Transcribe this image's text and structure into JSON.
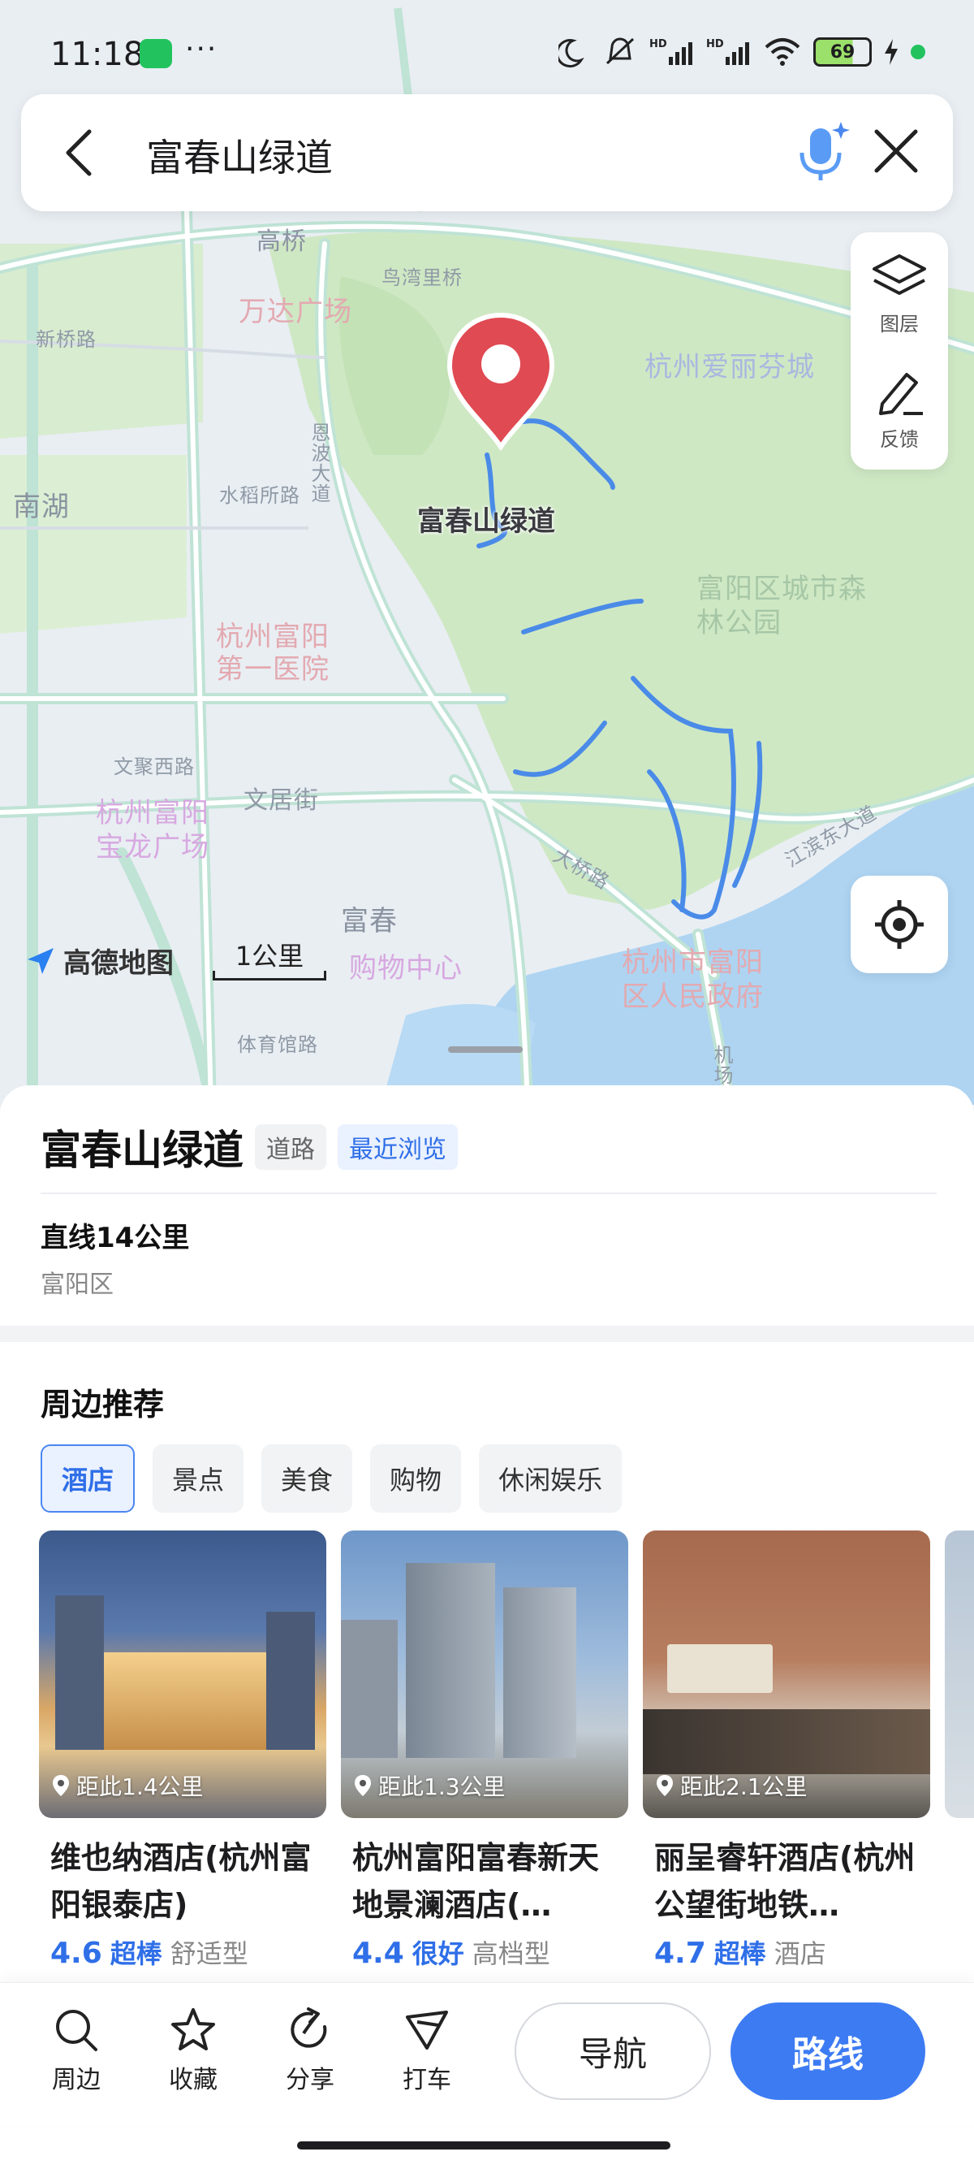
{
  "status": {
    "time": "11:18",
    "more": "···",
    "battery": "69"
  },
  "search": {
    "query": "富春山绿道"
  },
  "map": {
    "labels": {
      "gaoqiao": "高桥",
      "wanda": "万达广场",
      "niaowanlilu": "鸟湾里桥",
      "aili": "杭州爱丽芬城",
      "xinqiaolu": "新桥路",
      "shuiguanlu": "水稻所路",
      "enbo": "恩波大道",
      "hospital": "杭州富阳第一医院",
      "chengshi_park": "富阳区城市森林公园",
      "wenjuxi": "文聚西路",
      "wenjujie": "文居街",
      "baolong": "杭州富阳宝龙广场",
      "fuchun": "富春",
      "gouwu": "购物中心",
      "daqiaolu": "大桥路",
      "jiangbin": "江滨东大道",
      "gov": "杭州市富阳区人民政府",
      "tiyuguan": "体育馆路",
      "nanhu": "南湖",
      "jichang": "机场"
    },
    "pin_label": "富春山绿道",
    "layers_label": "图层",
    "feedback_label": "反馈",
    "logo_text": "高德地图",
    "scale_text": "1公里"
  },
  "place": {
    "title": "富春山绿道",
    "tag_type": "道路",
    "tag_recent": "最近浏览",
    "distance": "直线14公里",
    "district": "富阳区"
  },
  "nearby": {
    "title": "周边推荐",
    "chips": [
      "酒店",
      "景点",
      "美食",
      "购物",
      "休闲娱乐"
    ],
    "cards": [
      {
        "name": "维也纳酒店(杭州富阳银泰店)",
        "distance": "距此1.4公里",
        "score": "4.6",
        "level": "超棒",
        "type": "舒适型"
      },
      {
        "name": "杭州富阳富春新天地景澜酒店(…",
        "distance": "距此1.3公里",
        "score": "4.4",
        "level": "很好",
        "type": "高档型"
      },
      {
        "name": "丽呈睿轩酒店(杭州公望街地铁…",
        "distance": "距此2.1公里",
        "score": "4.7",
        "level": "超棒",
        "type": "酒店"
      }
    ]
  },
  "toolbar": {
    "around": "周边",
    "favorite": "收藏",
    "share": "分享",
    "taxi": "打车",
    "navigate": "导航",
    "route": "路线"
  },
  "colors": {
    "accent": "#3d7bf3",
    "pin": "#e04a52",
    "trail": "#4a8be8",
    "park": "#cfe8c4",
    "water": "#aed4f2"
  }
}
